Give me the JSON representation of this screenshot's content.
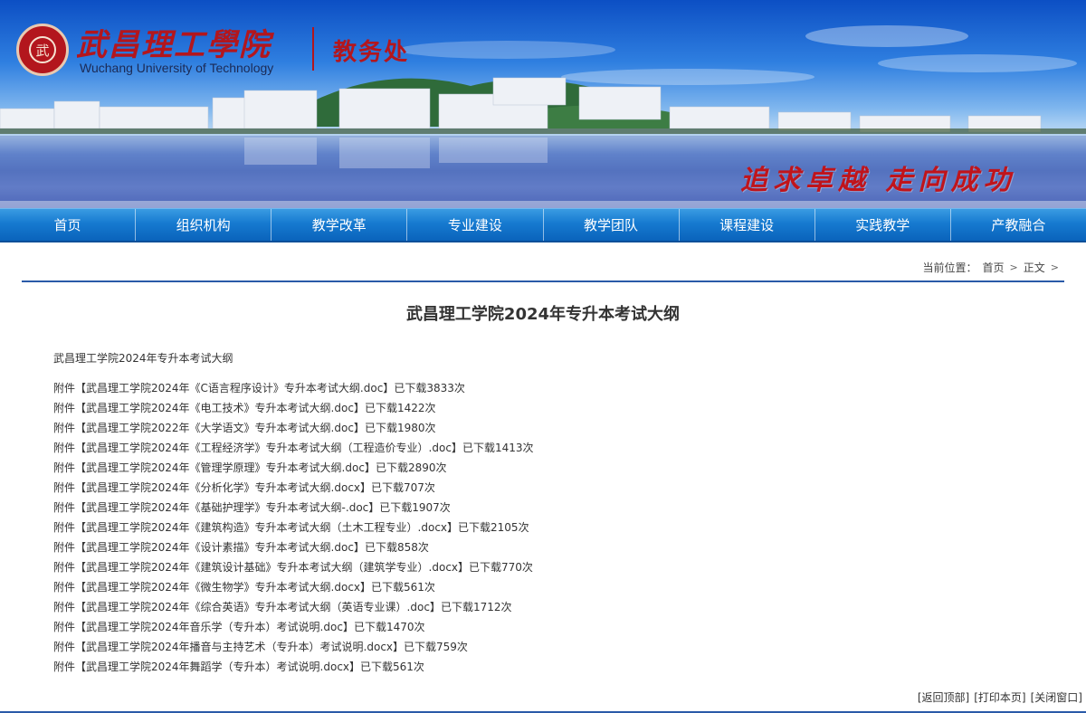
{
  "header": {
    "school_name_cn": "武昌理工學院",
    "school_name_en": "Wuchang University of Technology",
    "department": "教务处",
    "seal_glyph": "武",
    "slogan": "追求卓越 走向成功",
    "colors": {
      "brand_red": "#b3161d",
      "nav_blue": "#167ad0",
      "rule_blue": "#2a5aa8"
    }
  },
  "nav": {
    "items": [
      {
        "label": "首页"
      },
      {
        "label": "组织机构"
      },
      {
        "label": "教学改革"
      },
      {
        "label": "专业建设"
      },
      {
        "label": "教学团队"
      },
      {
        "label": "课程建设"
      },
      {
        "label": "实践教学"
      },
      {
        "label": "产教融合"
      }
    ]
  },
  "breadcrumb": {
    "prefix": "当前位置：",
    "items": [
      {
        "label": "首页"
      },
      {
        "label": "正文"
      }
    ],
    "separator": ">"
  },
  "article": {
    "title": "武昌理工学院2024年专升本考试大纲",
    "intro": "武昌理工学院2024年专升本考试大纲",
    "attachments": [
      {
        "label": "附件",
        "file": "【武昌理工学院2024年《C语言程序设计》专升本考试大纲.doc】",
        "count": "已下载3833次"
      },
      {
        "label": "附件",
        "file": "【武昌理工学院2024年《电工技术》专升本考试大纲.doc】",
        "count": "已下载1422次"
      },
      {
        "label": "附件",
        "file": "【武昌理工学院2022年《大学语文》专升本考试大纲.doc】",
        "count": "已下载1980次"
      },
      {
        "label": "附件",
        "file": "【武昌理工学院2024年《工程经济学》专升本考试大纲（工程造价专业）.doc】",
        "count": "已下载1413次"
      },
      {
        "label": "附件",
        "file": "【武昌理工学院2024年《管理学原理》专升本考试大纲.doc】",
        "count": "已下载2890次"
      },
      {
        "label": "附件",
        "file": "【武昌理工学院2024年《分析化学》专升本考试大纲.docx】",
        "count": "已下载707次"
      },
      {
        "label": "附件",
        "file": "【武昌理工学院2024年《基础护理学》专升本考试大纲-.doc】",
        "count": "已下载1907次"
      },
      {
        "label": "附件",
        "file": "【武昌理工学院2024年《建筑构造》专升本考试大纲（土木工程专业）.docx】",
        "count": "已下载2105次"
      },
      {
        "label": "附件",
        "file": "【武昌理工学院2024年《设计素描》专升本考试大纲.doc】",
        "count": "已下载858次"
      },
      {
        "label": "附件",
        "file": "【武昌理工学院2024年《建筑设计基础》专升本考试大纲（建筑学专业）.docx】",
        "count": "已下载770次"
      },
      {
        "label": "附件",
        "file": "【武昌理工学院2024年《微生物学》专升本考试大纲.docx】",
        "count": "已下载561次"
      },
      {
        "label": "附件",
        "file": "【武昌理工学院2024年《综合英语》专升本考试大纲（英语专业课）.doc】",
        "count": "已下载1712次"
      },
      {
        "label": "附件",
        "file": "【武昌理工学院2024年音乐学（专升本）考试说明.doc】",
        "count": "已下载1470次"
      },
      {
        "label": "附件",
        "file": "【武昌理工学院2024年播音与主持艺术（专升本）考试说明.docx】",
        "count": "已下载759次"
      },
      {
        "label": "附件",
        "file": "【武昌理工学院2024年舞蹈学（专升本）考试说明.docx】",
        "count": "已下载561次"
      }
    ]
  },
  "tools": {
    "back_to_top": "[返回顶部]",
    "print": "[打印本页]",
    "close": "[关闭窗口]"
  }
}
